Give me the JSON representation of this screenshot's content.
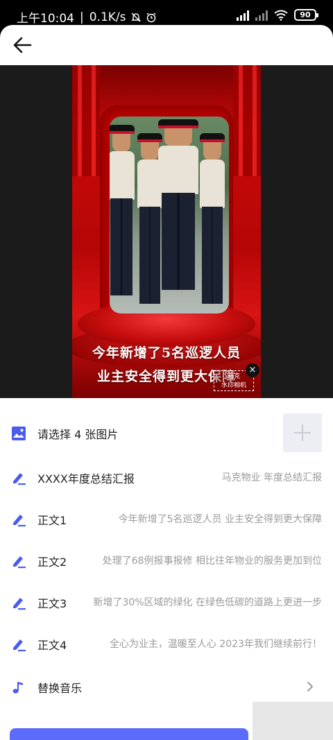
{
  "status_bar": {
    "time": "上午10:04",
    "separator": "|",
    "speed": "0.1K/s",
    "battery": "90"
  },
  "preview": {
    "caption_line1": "今年新增了5名巡逻人员",
    "caption_line2": "业主安全得到更大保障",
    "watermark_line1": "马克",
    "watermark_line2": "水印相机",
    "close_glyph": "×"
  },
  "form": {
    "image_picker": {
      "label": "请选择 4 张图片",
      "icon": "image-icon"
    },
    "title_row": {
      "label": "XXXX年度总结汇报",
      "value": "马克物业 年度总结汇报",
      "icon": "edit-icon"
    },
    "body_rows": [
      {
        "label": "正文1",
        "value": "今年新增了5名巡逻人员 业主安全得到更大保障",
        "icon": "edit-icon"
      },
      {
        "label": "正文2",
        "value": "处理了68例报事报修 相比往年物业的服务更加到位",
        "icon": "edit-icon"
      },
      {
        "label": "正文3",
        "value": "新增了30%区域的绿化 在绿色低碳的道路上更进一步",
        "icon": "edit-icon"
      },
      {
        "label": "正文4",
        "value": "全心为业主，温暖至人心 2023年我们继续前行！",
        "icon": "edit-icon"
      }
    ],
    "music_row": {
      "label": "替换音乐",
      "icon": "music-note-icon"
    }
  },
  "colors": {
    "accent": "#5d6bfa",
    "stage_red": "#c80a0a"
  }
}
